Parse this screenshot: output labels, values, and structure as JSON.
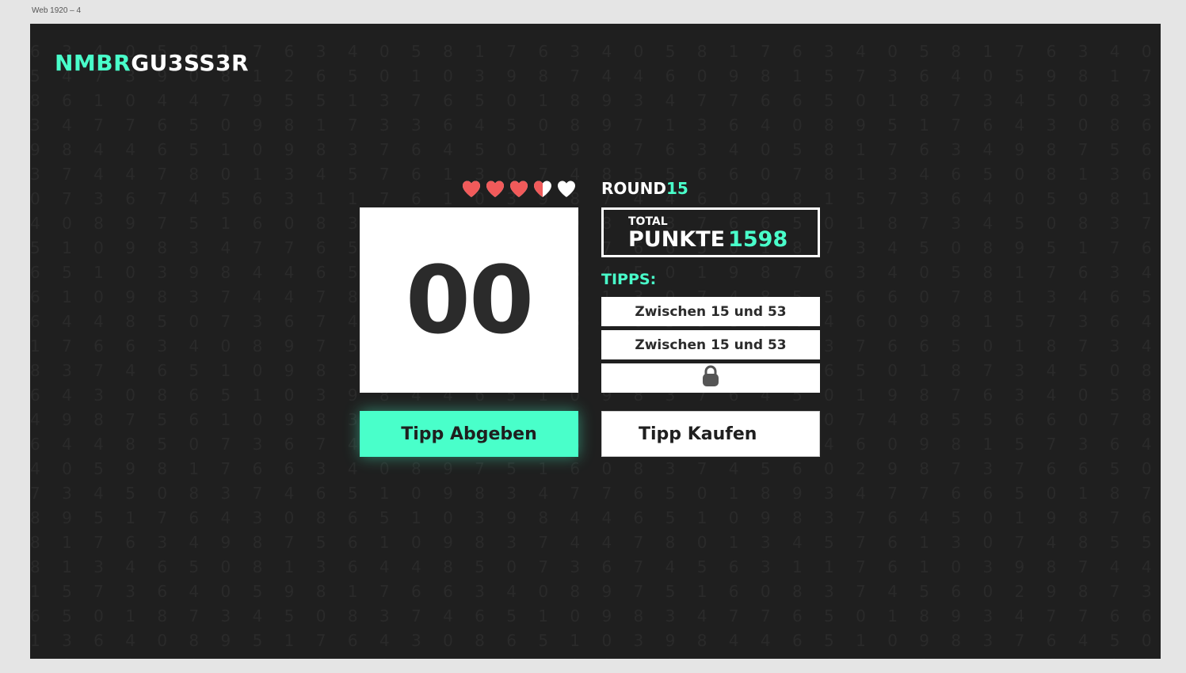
{
  "artboard_label": "Web 1920 – 4",
  "logo": {
    "accent": "NMBR",
    "rest": "GU3SS3R"
  },
  "colors": {
    "accent": "#49ffca",
    "heart_full": "#f15a5a",
    "heart_empty": "#ffffff",
    "background": "#1f1f1f"
  },
  "lives": {
    "full": 3.5,
    "total": 5
  },
  "round": {
    "label": "ROUND",
    "number": "15"
  },
  "score": {
    "total_label": "TOTAL",
    "punkte_label": "PUNKTE",
    "value": "1598"
  },
  "display": {
    "number": "00"
  },
  "tipps": {
    "label": "TIPPS:",
    "items": [
      "Zwischen 15 und 53",
      "Zwischen 15 und 53"
    ],
    "locked_icon": "lock-icon"
  },
  "buttons": {
    "submit": "Tipp Abgeben",
    "buy": "Tipp Kaufen"
  },
  "background_digits": [
    "6 3 4 0 5 8 1 7 6 3 4 0 5 8 1 7 6 3 4 0 5 8 1 7 6 3 4 0 5 8 1 7 6 3 4 0 5 8 1 7 6 3 4 0 5 8 1 7",
    "5 4 7 3 9 0 8 1 2 6 5 0 1 0 3 9 8 7 4 4 6 0 9 8 1 5 7 3 6 4 0 5 9 8 1 7 6 3 4 0 8 6",
    "8 6 1 0 4 4 7 9 5 5 1 3 7 6 5 0 1 8 9 3 4 7 7 6 6 5 0 1 8 7 3 4 5 0 8 3 7 4 6 5 1 0 9",
    "3 4 7 7 6 5 0 9 8 1 7 3 3 6 4 5 0 8 9 7 1 3 6 4 0 8 9 5 1 7 6 4 3 0 8 6 5 1 0",
    "9 8 4 4 6 5 1 0 9 8 3 7 6 4 5 0 1 9 8 7 6 3 4 0 5 8 1 7 6 3 4 9 8 7 5 6 1 0 9",
    "3 7 4 4 7 8 0 1 3 4 5 7 6 1 3 0 7 4 8 5 5 6 6 0 7 8 1 3 4 6 5 0 8 1 3 6 4 4 8",
    "0 7 3 6 7 4 5 6 3 1 1 7 6 1 0 3 9 8 7 4 4 6 0 9 8 1 5 7 3 6 4 0 5 9 8 1 7 6 3",
    "4 0 8 9 7 5 1 6 0 8 3 7 4 5 6 0 2 9 8 7 3 7 6 6 5 0 1 8 7 3 4 5 0 8 3 7 4 6 5",
    "5 1 0 9 8 3 4 7 7 6 5 0 1 8 9 3 4 7 7 6 6 5 0 1 8 7 3 4 5 0 8 9 5 1 7 6 4 3 0",
    "6 5 1 0 3 9 8 4 4 6 5 1 0 9 8 3 7 6 4 5 0 1 9 8 7 6 3 4 0 5 8 1 7 6 3 4 9 8 7",
    "6 1 0 9 8 3 7 4 4 7 8 0 1 3 4 5 7 6 1 3 0 7 4 8 5 5 6 6 0 7 8 1 3 4 6 5 0 8 1",
    "6 4 4 8 5 0 7 3 6 7 4 5 6 3 1 1 7 6 1 0 3 9 8 7 4 4 6 0 9 8 1 5 7 3 6 4 0 5 9",
    "1 7 6 6 3 4 0 8 9 7 5 1 6 0 8 3 7 4 5 6 0 2 9 8 7 3 7 6 6 5 0 1 8 7 3 4 5 0 8",
    "8 3 7 4 6 5 1 0 9 8 3 4 7 7 6 5 0 1 8 9 3 4 7 7 6 6 5 0 1 8 7 3 4 5 0 8 9 5 1",
    "6 4 3 0 8 6 5 1 0 3 9 8 4 4 6 5 1 0 9 8 3 7 6 4 5 0 1 9 8 7 6 3 4 0 5 8 1 7 6",
    "4 9 8 7 5 6 1 0 9 8 3 7 4 4 7 8 0 1 3 4 5 7 6 1 3 0 7 4 8 5 5 6 6 0 7 8 1 3 4",
    "6 4 4 8 5 0 7 3 6 7 4 5 6 3 1 1 7 6 1 0 3 9 8 7 4 4 6 0 9 8 1 5 7 3 6 4 0 5 9",
    "4 0 5 9 8 1 7 6 6 3 4 0 8 9 7 5 1 6 0 8 3 7 4 5 6 0 2 9 8 7 3 7 6 6 5 0 1 8 7",
    "7 3 4 5 0 8 3 7 4 6 5 1 0 9 8 3 4 7 7 6 5 0 1 8 9 3 4 7 7 6 6 5 0 1 8 7 3 4 5",
    "8 9 5 1 7 6 4 3 0 8 6 5 1 0 3 9 8 4 4 6 5 1 0 9 8 3 7 6 4 5 0 1 9 8 7 6 3 4 0",
    "8 1 7 6 3 4 9 8 7 5 6 1 0 9 8 3 7 4 4 7 8 0 1 3 4 5 7 6 1 3 0 7 4 8 5 5 6 6 0",
    "8 1 3 4 6 5 0 8 1 3 6 4 4 8 5 0 7 3 6 7 4 5 6 3 1 1 7 6 1 0 3 9 8 7 4 4 6 0 9",
    "1 5 7 3 6 4 0 5 9 8 1 7 6 6 3 4 0 8 9 7 5 1 6 0 8 3 7 4 5 6 0 2 9 8 7 3 7 6 6",
    "6 5 0 1 8 7 3 4 5 0 8 3 7 4 6 5 1 0 9 8 3 4 7 7 6 5 0 1 8 9 3 4 7 7 6 6 5 0 1",
    "1 3 6 4 0 8 9 5 1 7 6 4 3 0 8 6 5 1 0 3 9 8 4 4 6 5 1 0 9 8 3 7 6 4 5 0 1 9 8",
    "6 3 4 0 5 8 1 7 6 3 4 9 8 7 5 6 1 0 9 8 3 7 4 4 7 8 0 1 3 4 5 7 6 1 3 0 7 4 8"
  ]
}
